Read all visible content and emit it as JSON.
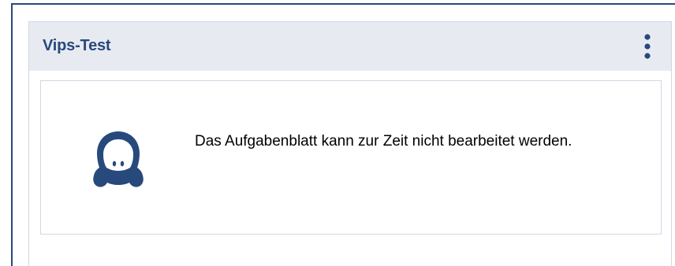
{
  "widget": {
    "title": "Vips-Test",
    "menu_icon": "kebab-vertical-icon"
  },
  "notice": {
    "icon": "mascot-icon",
    "message": "Das Aufgabenblatt kann zur Zeit nicht bearbeitet werden."
  },
  "colors": {
    "accent": "#28497c",
    "header_background": "#e7ebf1",
    "border": "#d0d7e3"
  }
}
